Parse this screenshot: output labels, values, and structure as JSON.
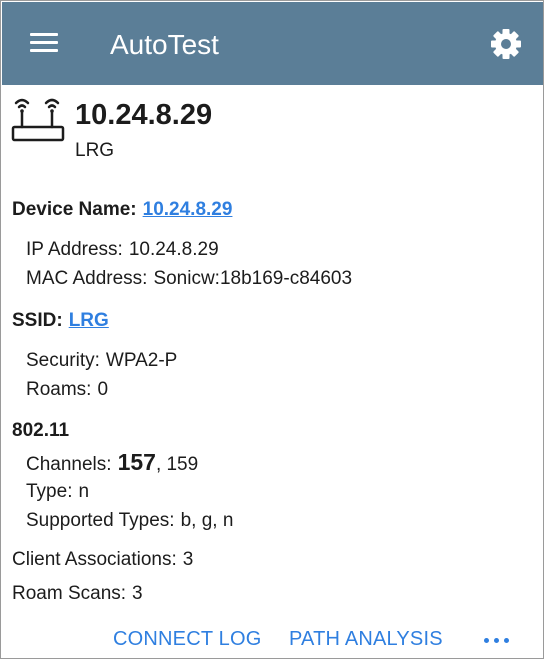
{
  "appbar": {
    "title": "AutoTest",
    "menu_icon": "menu-icon",
    "settings_icon": "gear-icon"
  },
  "device": {
    "icon": "access-point-icon",
    "ip": "10.24.8.29",
    "ssid": "LRG",
    "device_name_label": "Device Name:",
    "device_name_value": "10.24.8.29",
    "ip_label": "IP Address:",
    "ip_value": "10.24.8.29",
    "mac_label": "MAC Address:",
    "mac_value": "Sonicw:18b169-c84603"
  },
  "ssid_section": {
    "label": "SSID:",
    "value": "LRG",
    "security_label": "Security:",
    "security_value": "WPA2-P",
    "roams_label": "Roams:",
    "roams_value": "0"
  },
  "wifi": {
    "heading": "802.11",
    "channels_label": "Channels:",
    "channel_primary": "157",
    "channel_rest": ", 159",
    "type_label": "Type:",
    "type_value": "n",
    "supported_label": "Supported Types:",
    "supported_value": "b, g, n"
  },
  "stats": {
    "client_assoc_label": "Client Associations:",
    "client_assoc_value": "3",
    "roam_scans_label": "Roam Scans:",
    "roam_scans_value": "3"
  },
  "actions": {
    "connect_log": "CONNECT LOG",
    "path_analysis": "PATH ANALYSIS",
    "more_icon": "more-horiz-icon"
  },
  "colors": {
    "appbar": "#5b7e97",
    "link": "#2f7fe0"
  }
}
